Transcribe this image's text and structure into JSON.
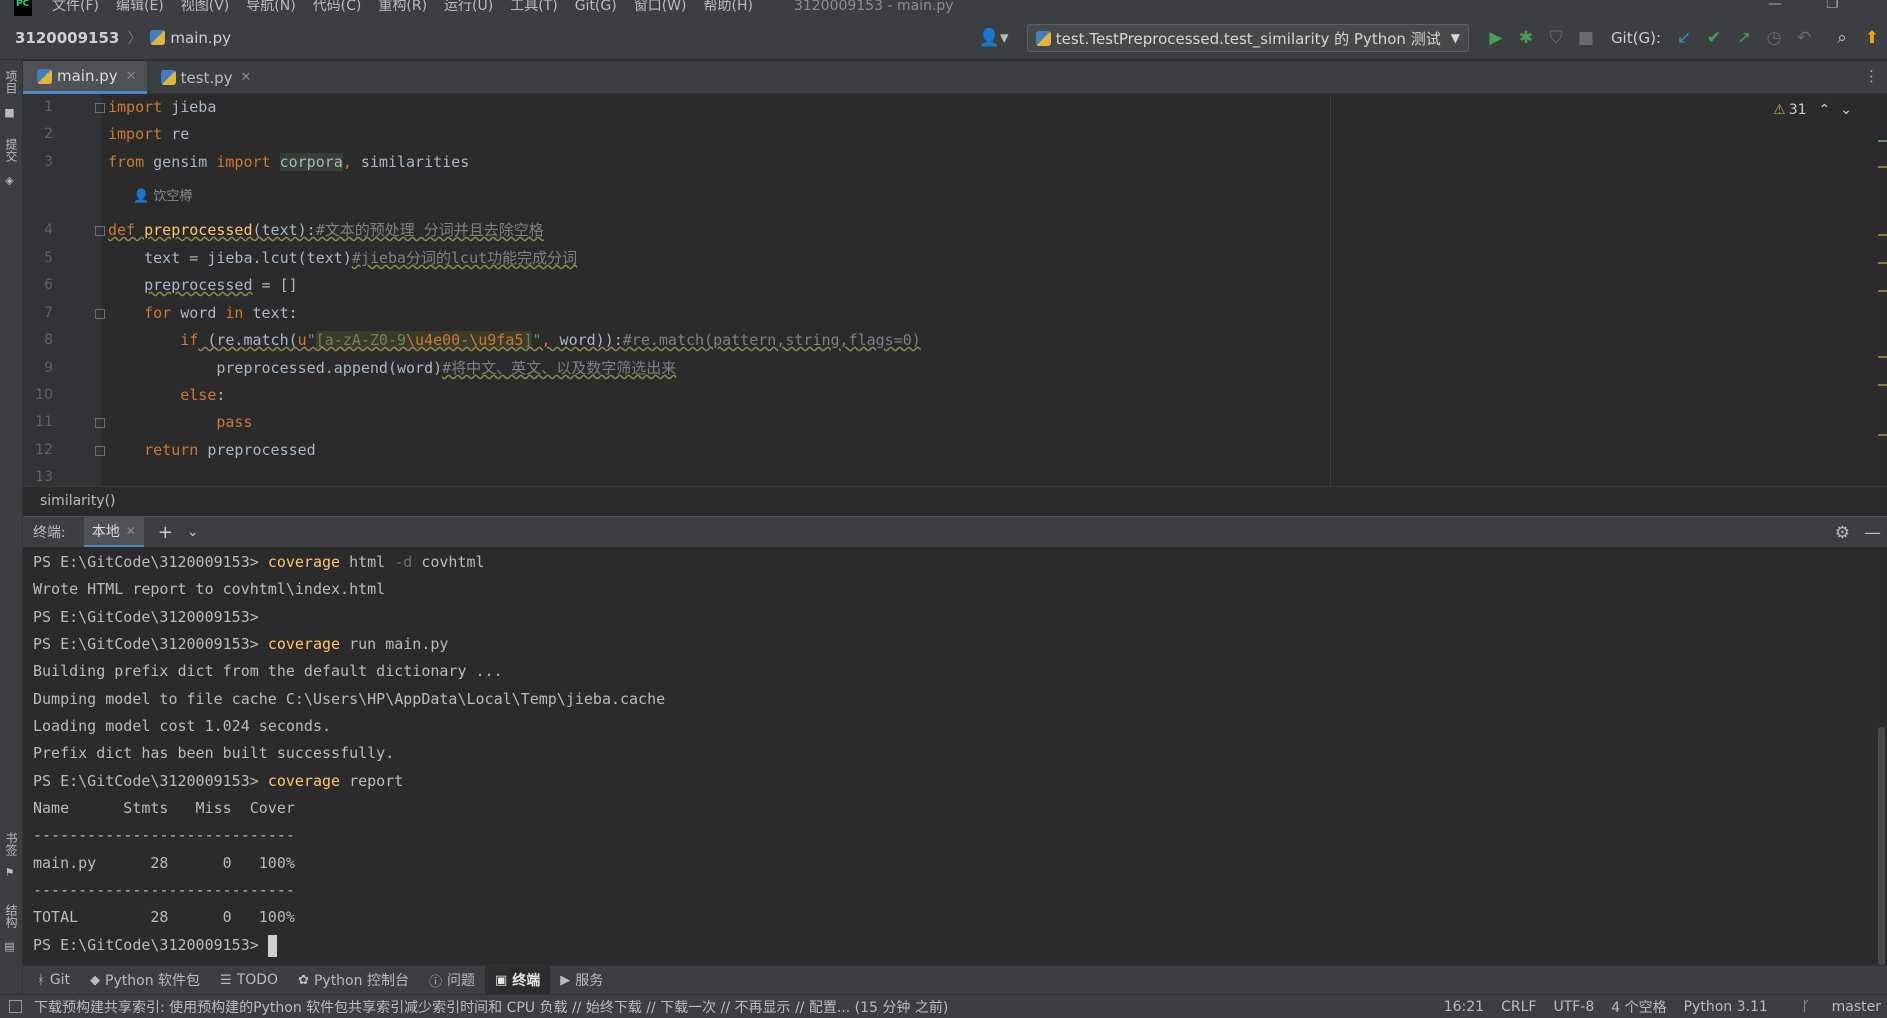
{
  "menubar": {
    "items": [
      "文件(F)",
      "编辑(E)",
      "视图(V)",
      "导航(N)",
      "代码(C)",
      "重构(R)",
      "运行(U)",
      "工具(T)",
      "Git(G)",
      "窗口(W)",
      "帮助(H)"
    ],
    "window_title": "3120009153 - main.py"
  },
  "navbar": {
    "project": "3120009153",
    "file": "main.py",
    "run_config": "test.TestPreprocessed.test_similarity 的 Python 测试",
    "git_label": "Git(G):"
  },
  "leftstrip": {
    "project": "项目",
    "commit": "提交",
    "bookmarks": "书签",
    "structure": "结构"
  },
  "tabs": [
    {
      "label": "main.py",
      "active": true
    },
    {
      "label": "test.py",
      "active": false
    }
  ],
  "editor": {
    "line_numbers": [
      "1",
      "2",
      "3",
      "4",
      "5",
      "6",
      "7",
      "8",
      "9",
      "10",
      "11",
      "12",
      "13"
    ],
    "author_hint": "饮空樽",
    "warnings": "31",
    "lines": {
      "l1": {
        "kw": "import",
        "rest": " jieba"
      },
      "l2": {
        "kw": "import",
        "rest": " re"
      },
      "l3": {
        "kw1": "from",
        "mod": " gensim ",
        "kw2": "import",
        "hl": "corpora",
        "comma": ",",
        "rest": " similarities"
      },
      "l4": {
        "kw": "def",
        "fn": "preprocessed",
        "sig": "(text):",
        "cmt": "#文本的预处理 分词并且去除空格"
      },
      "l5": {
        "code": "text = jieba.lcut(text)",
        "cmt": "#jieba分词的lcut功能完成分词"
      },
      "l6": {
        "var": "preprocessed",
        "rest": " = []"
      },
      "l7": {
        "kw1": "for",
        "a": " word ",
        "kw2": "in",
        "b": " text:"
      },
      "l8": {
        "kw": "if",
        "pre": " (re.match(",
        "u": "u",
        "q1": "\"",
        "cls1": "[a-zA-Z0-9",
        "esc": "\\u4e00-\\u9fa5",
        "cls2": "]",
        "q2": "\"",
        "comma": ",",
        "post": " word)):",
        "cmt": "#re.match(pattern,string,flags=0)"
      },
      "l9": {
        "code": "preprocessed.append(word)",
        "cmt": "#将中文、英文、以及数字筛选出来"
      },
      "l10": {
        "kw": "else",
        "rest": ":"
      },
      "l11": {
        "kw": "pass"
      },
      "l12": {
        "kw": "return",
        "rest": " preprocessed"
      }
    }
  },
  "breadcrumb": "similarity()",
  "terminal": {
    "title": "终端:",
    "tab": "本地",
    "lines": {
      "t1": {
        "prompt": "PS E:\\GitCode\\3120009153> ",
        "cmd": "coverage",
        "a": " html ",
        "flag": "-d",
        "b": " covhtml"
      },
      "t2": "Wrote HTML report to covhtml\\index.html",
      "t3": "PS E:\\GitCode\\3120009153>",
      "t4": {
        "prompt": "PS E:\\GitCode\\3120009153> ",
        "cmd": "coverage",
        "a": " run main.py"
      },
      "t5": "Building prefix dict from the default dictionary ...",
      "t6": "Dumping model to file cache C:\\Users\\HP\\AppData\\Local\\Temp\\jieba.cache",
      "t7": "Loading model cost 1.024 seconds.",
      "t8": "Prefix dict has been built successfully.",
      "t9": {
        "prompt": "PS E:\\GitCode\\3120009153> ",
        "cmd": "coverage",
        "a": " report"
      },
      "t10": "Name      Stmts   Miss  Cover",
      "t11": "-----------------------------",
      "t12": "main.py      28      0   100%",
      "t13": "-----------------------------",
      "t14": "TOTAL        28      0   100%",
      "t15": "PS E:\\GitCode\\3120009153> "
    }
  },
  "toolwindows": [
    {
      "label": "Git",
      "icon": "git-icon",
      "active": false
    },
    {
      "label": "Python 软件包",
      "icon": "packages-icon",
      "active": false
    },
    {
      "label": "TODO",
      "icon": "todo-icon",
      "active": false
    },
    {
      "label": "Python 控制台",
      "icon": "python-console-icon",
      "active": false
    },
    {
      "label": "问题",
      "icon": "problems-icon",
      "active": false
    },
    {
      "label": "终端",
      "icon": "terminal-icon",
      "active": true
    },
    {
      "label": "服务",
      "icon": "services-icon",
      "active": false
    }
  ],
  "statusbar": {
    "message": "下载预构建共享索引: 使用预构建的Python 软件包共享索引减少索引时间和 CPU 负载 // 始终下载 // 下载一次 // 不再显示 // 配置... (15 分钟 之前)",
    "position": "16:21",
    "line_sep": "CRLF",
    "encoding": "UTF-8",
    "indent": "4 个空格",
    "interpreter": "Python 3.11",
    "branch": "master"
  },
  "colors": {
    "accent": "#4a88c7",
    "keyword": "#cc7832",
    "function": "#ffc66d",
    "string": "#6a8759",
    "comment": "#808080"
  }
}
